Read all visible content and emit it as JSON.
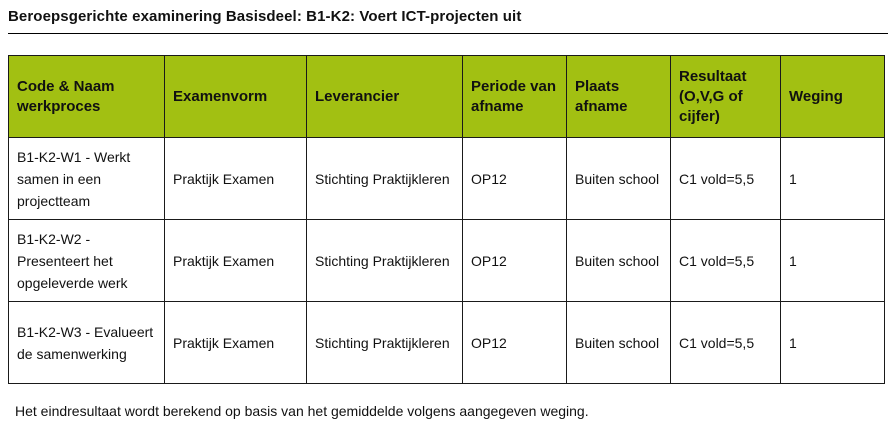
{
  "page": {
    "title": "Beroepsgerichte examinering Basisdeel: B1-K2: Voert ICT-projecten uit",
    "footer_note": "Het eindresultaat wordt berekend op basis van het gemiddelde volgens aangegeven weging.",
    "header_color": "#a2c012"
  },
  "table": {
    "headers": [
      "Code & Naam werkproces",
      "Examenvorm",
      "Leverancier",
      "Periode van afname",
      "Plaats afname",
      "Resultaat (O,V,G of cijfer)",
      "Weging"
    ],
    "rows": [
      [
        "B1-K2-W1 - Werkt samen in een projectteam",
        "Praktijk Examen",
        "Stichting Praktijkleren",
        "OP12",
        "Buiten school",
        "C1 vold=5,5",
        "1"
      ],
      [
        "B1-K2-W2 - Presenteert het opgeleverde werk",
        "Praktijk Examen",
        "Stichting Praktijkleren",
        "OP12",
        "Buiten school",
        "C1 vold=5,5",
        "1"
      ],
      [
        "B1-K2-W3 - Evalueert de samenwerking",
        "Praktijk Examen",
        "Stichting Praktijkleren",
        "OP12",
        "Buiten school",
        "C1 vold=5,5",
        "1"
      ]
    ]
  }
}
